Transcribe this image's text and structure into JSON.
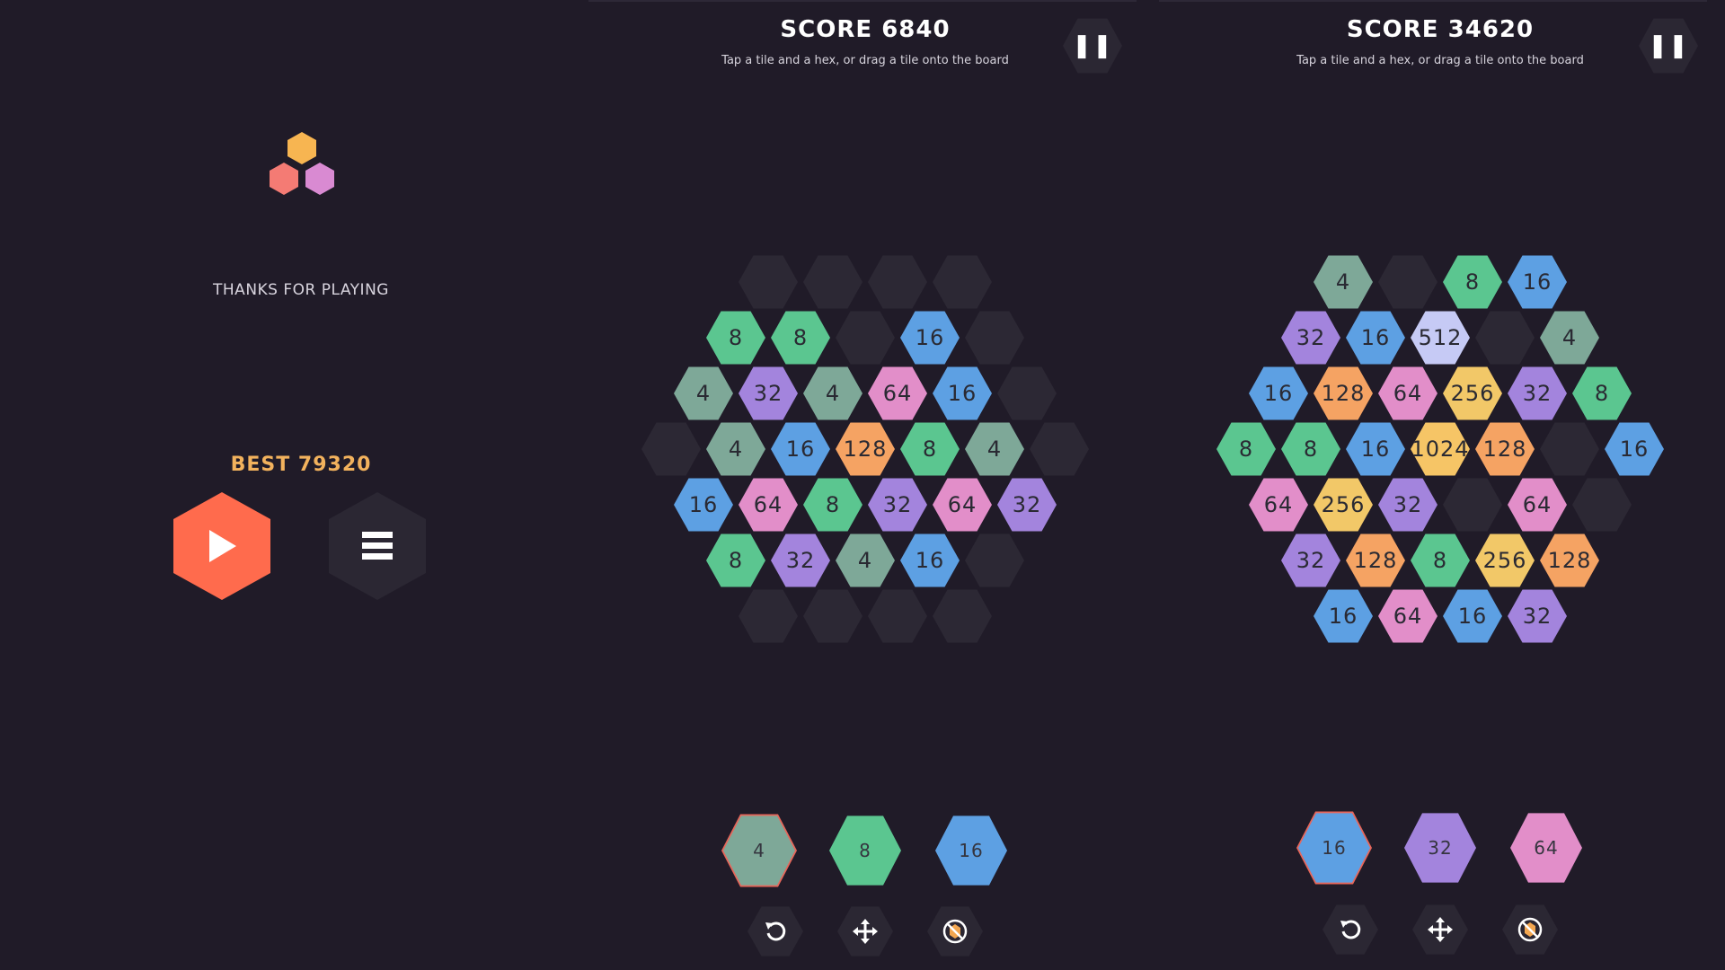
{
  "menu": {
    "logo_colors": [
      "#f7b551",
      "#f47b74",
      "#d98ad2"
    ],
    "thanks": "THANKS FOR PLAYING",
    "best_label": "BEST",
    "best_value": "79320",
    "play_icon": "play-icon",
    "menu_icon": "hamburger-icon"
  },
  "colors": {
    "4": "#7ea898",
    "8": "#5bc690",
    "16": "#5da0e3",
    "32": "#a384dd",
    "64": "#e28ec9",
    "128": "#f5a363",
    "256": "#f2c868",
    "512": "#c6caf5",
    "1024": "#f6c566",
    "empty": "#2c2834",
    "accent": "#ff6b4d",
    "selected_border": "#e7665a"
  },
  "game1": {
    "score_label": "SCORE",
    "score_value": "6840",
    "hint": "Tap a tile and a hex, or drag a tile onto the board",
    "rows": [
      [
        "",
        "",
        "",
        ""
      ],
      [
        "8",
        "8",
        "",
        "16",
        ""
      ],
      [
        "4",
        "32",
        "4",
        "64",
        "16",
        ""
      ],
      [
        "",
        "4",
        "16",
        "128",
        "8",
        "4",
        ""
      ],
      [
        "16",
        "64",
        "8",
        "32",
        "64",
        "32"
      ],
      [
        "8",
        "32",
        "4",
        "16",
        ""
      ],
      [
        "",
        "",
        "",
        ""
      ]
    ],
    "tray": [
      "4",
      "8",
      "16"
    ],
    "selected_tray": 0,
    "tools": [
      "undo-icon",
      "move-icon",
      "bomb-icon"
    ]
  },
  "game2": {
    "score_label": "SCORE",
    "score_value": "34620",
    "hint": "Tap a tile and a hex, or drag a tile onto the board",
    "rows": [
      [
        "4",
        "",
        "8",
        "16"
      ],
      [
        "32",
        "16",
        "512",
        "",
        "4"
      ],
      [
        "16",
        "128",
        "64",
        "256",
        "32",
        "8"
      ],
      [
        "8",
        "8",
        "16",
        "1024",
        "128",
        "",
        "16"
      ],
      [
        "64",
        "256",
        "32",
        "",
        "64",
        ""
      ],
      [
        "32",
        "128",
        "8",
        "256",
        "128"
      ],
      [
        "16",
        "64",
        "16",
        "32"
      ]
    ],
    "tray": [
      "16",
      "32",
      "64"
    ],
    "selected_tray": 0,
    "tools": [
      "undo-icon",
      "move-icon",
      "bomb-icon"
    ]
  }
}
